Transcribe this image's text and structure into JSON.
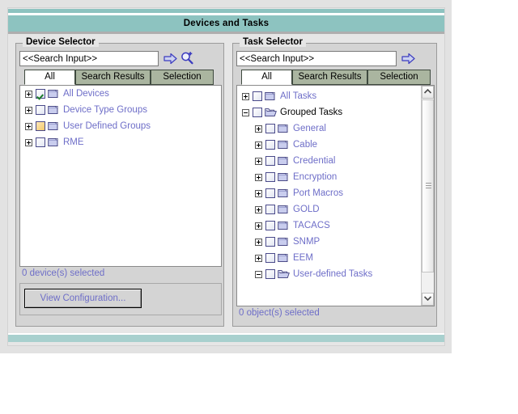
{
  "window": {
    "title": "Devices and Tasks"
  },
  "device_selector": {
    "legend": "Device Selector",
    "search": {
      "value": "<<Search Input>>",
      "placeholder": "<<Search Input>>",
      "go_icon": "arrow-right-icon",
      "advanced_icon": "magnifier-plus-icon"
    },
    "tabs": [
      {
        "label": "All",
        "active": true
      },
      {
        "label": "Search Results",
        "active": false
      },
      {
        "label": "Selection",
        "active": false
      }
    ],
    "tree": [
      {
        "label": "All Devices",
        "indent": 0,
        "expander": "plus",
        "checkbox": "checked",
        "folder": "closed",
        "style": "link"
      },
      {
        "label": "Device Type Groups",
        "indent": 0,
        "expander": "plus",
        "checkbox": "empty",
        "folder": "closed",
        "style": "link"
      },
      {
        "label": "User Defined Groups",
        "indent": 0,
        "expander": "plus",
        "checkbox": "filled",
        "folder": "closed",
        "style": "link"
      },
      {
        "label": "RME",
        "indent": 0,
        "expander": "plus",
        "checkbox": "empty",
        "folder": "closed",
        "style": "link"
      }
    ],
    "status": "0 device(s) selected",
    "view_config_button": "View Configuration..."
  },
  "task_selector": {
    "legend": "Task Selector",
    "search": {
      "value": "<<Search Input>>",
      "placeholder": "<<Search Input>>",
      "go_icon": "arrow-right-icon"
    },
    "tabs": [
      {
        "label": "All",
        "active": true
      },
      {
        "label": "Search Results",
        "active": false
      },
      {
        "label": "Selection",
        "active": false
      }
    ],
    "tree": [
      {
        "label": "All Tasks",
        "indent": 0,
        "expander": "plus",
        "checkbox": "empty",
        "folder": "closed",
        "style": "link"
      },
      {
        "label": "Grouped Tasks",
        "indent": 0,
        "expander": "minus",
        "checkbox": "empty",
        "folder": "open",
        "style": "plain"
      },
      {
        "label": "General",
        "indent": 1,
        "expander": "plus",
        "checkbox": "empty",
        "folder": "closed",
        "style": "link"
      },
      {
        "label": "Cable",
        "indent": 1,
        "expander": "plus",
        "checkbox": "empty",
        "folder": "closed",
        "style": "link"
      },
      {
        "label": "Credential",
        "indent": 1,
        "expander": "plus",
        "checkbox": "empty",
        "folder": "closed",
        "style": "link"
      },
      {
        "label": "Encryption",
        "indent": 1,
        "expander": "plus",
        "checkbox": "empty",
        "folder": "closed",
        "style": "link"
      },
      {
        "label": "Port Macros",
        "indent": 1,
        "expander": "plus",
        "checkbox": "empty",
        "folder": "closed",
        "style": "link"
      },
      {
        "label": "GOLD",
        "indent": 1,
        "expander": "plus",
        "checkbox": "empty",
        "folder": "closed",
        "style": "link"
      },
      {
        "label": "TACACS",
        "indent": 1,
        "expander": "plus",
        "checkbox": "empty",
        "folder": "closed",
        "style": "link"
      },
      {
        "label": "SNMP",
        "indent": 1,
        "expander": "plus",
        "checkbox": "empty",
        "folder": "closed",
        "style": "link"
      },
      {
        "label": "EEM",
        "indent": 1,
        "expander": "plus",
        "checkbox": "empty",
        "folder": "closed",
        "style": "link"
      },
      {
        "label": "User-defined Tasks",
        "indent": 1,
        "expander": "minus",
        "checkbox": "empty",
        "folder": "open",
        "style": "link"
      }
    ],
    "status": "0 object(s) selected",
    "scrollbar": {
      "up_icon": "chevron-up-icon",
      "down_icon": "chevron-down-icon"
    }
  },
  "colors": {
    "title_bar": "#8dc3c0",
    "link_text": "#6e6ec8",
    "tab_inactive": "#aab5a0",
    "panel": "#d4d4d4",
    "checkbox_filled": "#f3c96a",
    "check_mark": "#1a7a2a"
  }
}
